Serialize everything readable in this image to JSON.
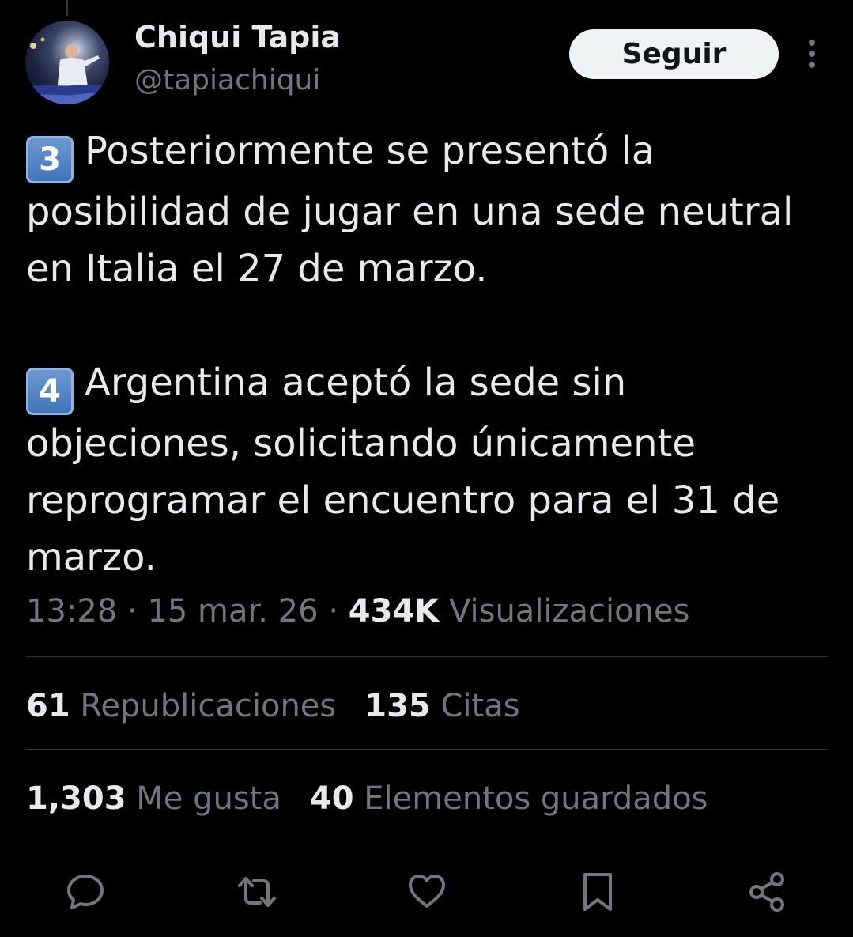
{
  "author": {
    "display_name": "Chiqui Tapia",
    "handle": "@tapiachiqui",
    "follow_label": "Seguir"
  },
  "tweet": {
    "paragraphs": [
      {
        "keycap": "3",
        "text": "Posteriormente se presentó la posibilidad de jugar en una sede neutral en Italia el 27 de marzo."
      },
      {
        "keycap": "4",
        "text": "Argentina aceptó la sede sin objeciones, solicitando únicamente reprogramar el encuentro para el 31 de marzo."
      }
    ],
    "time": "13:28",
    "separator": "·",
    "date": "15 mar. 26",
    "views_count": "434K",
    "views_label": "Visualizaciones"
  },
  "stats": {
    "reposts_count": "61",
    "reposts_label": "Republicaciones",
    "quotes_count": "135",
    "quotes_label": "Citas",
    "likes_count": "1,303",
    "likes_label": "Me gusta",
    "bookmarks_count": "40",
    "bookmarks_label": "Elementos guardados"
  },
  "icons": {
    "more": "more-vertical-icon",
    "reply": "reply-icon",
    "repost": "repost-icon",
    "like": "heart-icon",
    "bookmark": "bookmark-icon",
    "share": "share-icon"
  },
  "colors": {
    "background": "#000000",
    "text_primary": "#e7e9ea",
    "text_secondary": "#71767b",
    "divider": "#2f3336",
    "follow_button_bg": "#eff3f4",
    "keycap_blue": "#4f81c4"
  }
}
